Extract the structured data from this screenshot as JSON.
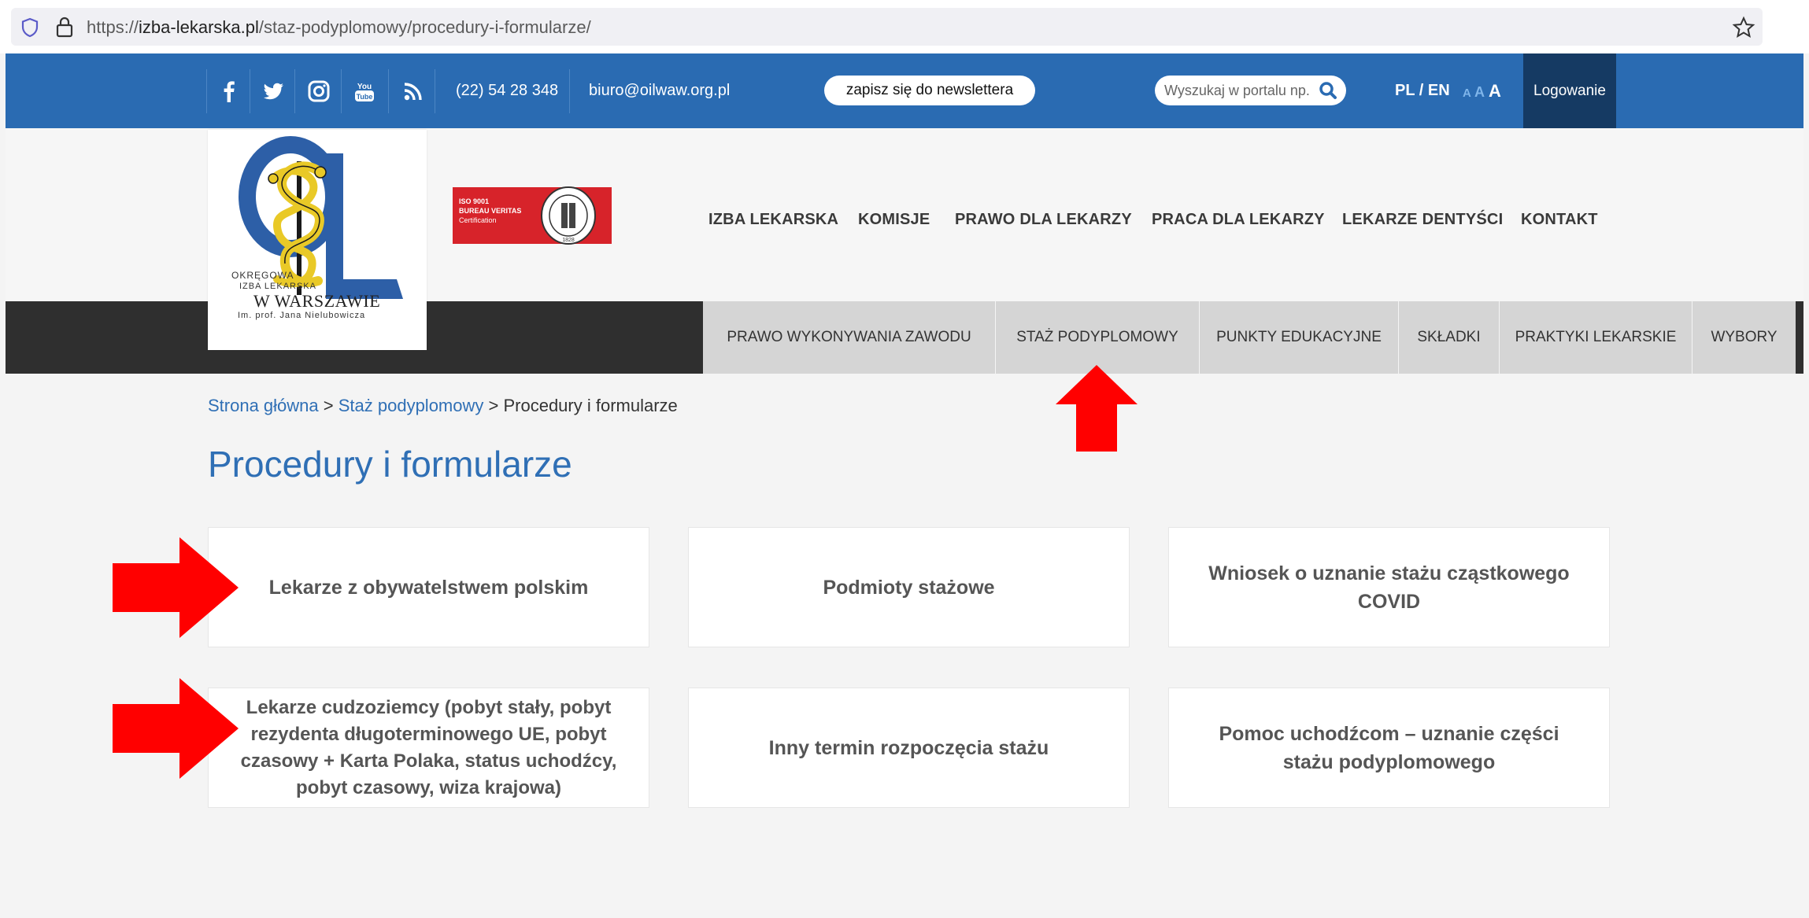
{
  "browser": {
    "url_prefix": "https://",
    "url_host": "izba-lekarska.pl",
    "url_path": "/staz-podyplomowy/procedury-i-formularze/"
  },
  "topbar": {
    "social_icons": [
      "facebook-icon",
      "twitter-icon",
      "instagram-icon",
      "youtube-icon",
      "rss-icon"
    ],
    "phone": "(22) 54 28 348",
    "email": "biuro@oilwaw.org.pl",
    "newsletter_label": "zapisz się do newslettera",
    "search_placeholder": "Wyszukaj w portalu np. s",
    "lang_label": "PL / EN",
    "font_sizes": [
      "A",
      "A",
      "A"
    ],
    "login_label": "Logowanie"
  },
  "logo": {
    "line1": "OKRĘGOWA",
    "line2": "IZBA LEKARSKA",
    "line3": "W WARSZAWIE",
    "line4": "Im. prof. Jana Nielubowicza"
  },
  "iso_badge": {
    "line1": "ISO 9001",
    "line2": "BUREAU VERITAS",
    "line3": "Certification",
    "seal_year": "1828"
  },
  "main_nav": [
    "IZBA LEKARSKA",
    "KOMISJE",
    "PRAWO DLA LEKARZY",
    "PRACA DLA LEKARZY",
    "LEKARZE DENTYŚCI",
    "KONTAKT"
  ],
  "sub_nav": [
    "PRAWO WYKONYWANIA ZAWODU",
    "STAŻ PODYPLOMOWY",
    "PUNKTY EDUKACYJNE",
    "SKŁADKI",
    "PRAKTYKI LEKARSKIE",
    "WYBORY"
  ],
  "breadcrumb": {
    "home": "Strona główna",
    "sep1": " > ",
    "section": "Staż podyplomowy",
    "sep2": " > ",
    "current": "Procedury i formularze"
  },
  "page_title": "Procedury i formularze",
  "cards": [
    "Lekarze z obywatelstwem polskim",
    "Podmioty stażowe",
    "Wniosek o uznanie stażu cząstkowego COVID",
    "Lekarze cudzoziemcy (pobyt stały, pobyt rezydenta długoterminowego UE, pobyt czasowy + Karta Polaka, status uchodźcy, pobyt czasowy, wiza krajowa)",
    "Inny termin rozpoczęcia stażu",
    "Pomoc uchodźcom – uznanie części stażu podyplomowego"
  ],
  "colors": {
    "topbar": "#2a6bb2",
    "login": "#153a63",
    "subbar": "#2f2f2f",
    "subnav": "#d5d5d5",
    "link": "#2f6fb5",
    "annotation_arrow": "#ff0000"
  }
}
